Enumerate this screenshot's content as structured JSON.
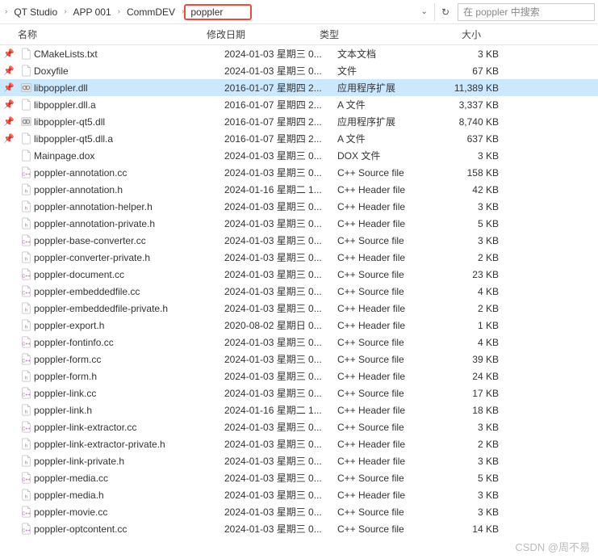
{
  "breadcrumb": [
    "QT Studio",
    "APP 001",
    "CommDEV",
    "poppler"
  ],
  "search_placeholder": "在 poppler 中搜索",
  "headers": {
    "name": "名称",
    "date": "修改日期",
    "type": "类型",
    "size": "大小"
  },
  "watermark": "CSDN @周不易",
  "files": [
    {
      "pin": true,
      "icon": "txt",
      "name": "CMakeLists.txt",
      "date": "2024-01-03 星期三 0...",
      "type": "文本文档",
      "size": "3 KB"
    },
    {
      "pin": true,
      "icon": "folder",
      "name": "Doxyfile",
      "date": "2024-01-03 星期三 0...",
      "type": "文件",
      "size": "67 KB"
    },
    {
      "pin": true,
      "icon": "dll",
      "name": "libpoppler.dll",
      "date": "2016-01-07 星期四 2...",
      "type": "应用程序扩展",
      "size": "11,389 KB",
      "selected": true
    },
    {
      "pin": true,
      "icon": "a",
      "name": "libpoppler.dll.a",
      "date": "2016-01-07 星期四 2...",
      "type": "A 文件",
      "size": "3,337 KB"
    },
    {
      "pin": true,
      "icon": "dll",
      "name": "libpoppler-qt5.dll",
      "date": "2016-01-07 星期四 2...",
      "type": "应用程序扩展",
      "size": "8,740 KB"
    },
    {
      "pin": true,
      "icon": "a",
      "name": "libpoppler-qt5.dll.a",
      "date": "2016-01-07 星期四 2...",
      "type": "A 文件",
      "size": "637 KB"
    },
    {
      "pin": false,
      "icon": "file",
      "name": "Mainpage.dox",
      "date": "2024-01-03 星期三 0...",
      "type": "DOX 文件",
      "size": "3 KB"
    },
    {
      "pin": false,
      "icon": "cpp",
      "name": "poppler-annotation.cc",
      "date": "2024-01-03 星期三 0...",
      "type": "C++ Source file",
      "size": "158 KB"
    },
    {
      "pin": false,
      "icon": "h",
      "name": "poppler-annotation.h",
      "date": "2024-01-16 星期二 1...",
      "type": "C++ Header file",
      "size": "42 KB"
    },
    {
      "pin": false,
      "icon": "h",
      "name": "poppler-annotation-helper.h",
      "date": "2024-01-03 星期三 0...",
      "type": "C++ Header file",
      "size": "3 KB"
    },
    {
      "pin": false,
      "icon": "h",
      "name": "poppler-annotation-private.h",
      "date": "2024-01-03 星期三 0...",
      "type": "C++ Header file",
      "size": "5 KB"
    },
    {
      "pin": false,
      "icon": "cpp",
      "name": "poppler-base-converter.cc",
      "date": "2024-01-03 星期三 0...",
      "type": "C++ Source file",
      "size": "3 KB"
    },
    {
      "pin": false,
      "icon": "h",
      "name": "poppler-converter-private.h",
      "date": "2024-01-03 星期三 0...",
      "type": "C++ Header file",
      "size": "2 KB"
    },
    {
      "pin": false,
      "icon": "cpp",
      "name": "poppler-document.cc",
      "date": "2024-01-03 星期三 0...",
      "type": "C++ Source file",
      "size": "23 KB"
    },
    {
      "pin": false,
      "icon": "cpp",
      "name": "poppler-embeddedfile.cc",
      "date": "2024-01-03 星期三 0...",
      "type": "C++ Source file",
      "size": "4 KB"
    },
    {
      "pin": false,
      "icon": "h",
      "name": "poppler-embeddedfile-private.h",
      "date": "2024-01-03 星期三 0...",
      "type": "C++ Header file",
      "size": "2 KB"
    },
    {
      "pin": false,
      "icon": "h",
      "name": "poppler-export.h",
      "date": "2020-08-02 星期日 0...",
      "type": "C++ Header file",
      "size": "1 KB"
    },
    {
      "pin": false,
      "icon": "cpp",
      "name": "poppler-fontinfo.cc",
      "date": "2024-01-03 星期三 0...",
      "type": "C++ Source file",
      "size": "4 KB"
    },
    {
      "pin": false,
      "icon": "cpp",
      "name": "poppler-form.cc",
      "date": "2024-01-03 星期三 0...",
      "type": "C++ Source file",
      "size": "39 KB"
    },
    {
      "pin": false,
      "icon": "h",
      "name": "poppler-form.h",
      "date": "2024-01-03 星期三 0...",
      "type": "C++ Header file",
      "size": "24 KB"
    },
    {
      "pin": false,
      "icon": "cpp",
      "name": "poppler-link.cc",
      "date": "2024-01-03 星期三 0...",
      "type": "C++ Source file",
      "size": "17 KB"
    },
    {
      "pin": false,
      "icon": "h",
      "name": "poppler-link.h",
      "date": "2024-01-16 星期二 1...",
      "type": "C++ Header file",
      "size": "18 KB"
    },
    {
      "pin": false,
      "icon": "cpp",
      "name": "poppler-link-extractor.cc",
      "date": "2024-01-03 星期三 0...",
      "type": "C++ Source file",
      "size": "3 KB"
    },
    {
      "pin": false,
      "icon": "h",
      "name": "poppler-link-extractor-private.h",
      "date": "2024-01-03 星期三 0...",
      "type": "C++ Header file",
      "size": "2 KB"
    },
    {
      "pin": false,
      "icon": "h",
      "name": "poppler-link-private.h",
      "date": "2024-01-03 星期三 0...",
      "type": "C++ Header file",
      "size": "3 KB"
    },
    {
      "pin": false,
      "icon": "cpp",
      "name": "poppler-media.cc",
      "date": "2024-01-03 星期三 0...",
      "type": "C++ Source file",
      "size": "5 KB"
    },
    {
      "pin": false,
      "icon": "h",
      "name": "poppler-media.h",
      "date": "2024-01-03 星期三 0...",
      "type": "C++ Header file",
      "size": "3 KB"
    },
    {
      "pin": false,
      "icon": "cpp",
      "name": "poppler-movie.cc",
      "date": "2024-01-03 星期三 0...",
      "type": "C++ Source file",
      "size": "3 KB"
    },
    {
      "pin": false,
      "icon": "cpp",
      "name": "poppler-optcontent.cc",
      "date": "2024-01-03 星期三 0...",
      "type": "C++ Source file",
      "size": "14 KB"
    }
  ]
}
